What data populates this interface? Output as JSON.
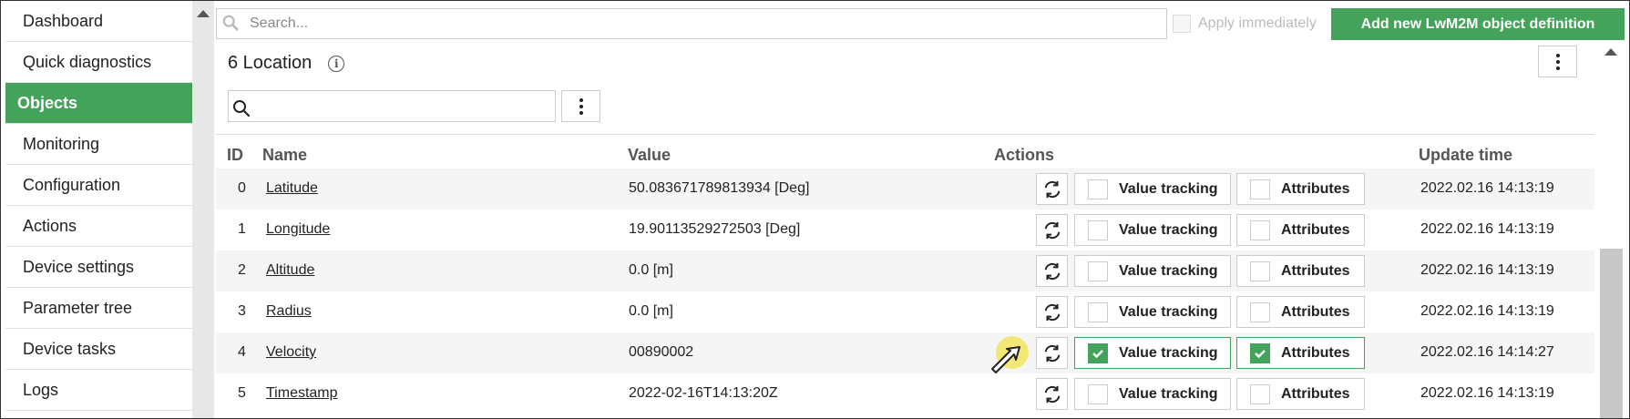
{
  "sidebar": {
    "items": [
      {
        "label": "Dashboard",
        "active": false
      },
      {
        "label": "Quick diagnostics",
        "active": false
      },
      {
        "label": "Objects",
        "active": true
      },
      {
        "label": "Monitoring",
        "active": false
      },
      {
        "label": "Configuration",
        "active": false
      },
      {
        "label": "Actions",
        "active": false
      },
      {
        "label": "Device settings",
        "active": false
      },
      {
        "label": "Parameter tree",
        "active": false
      },
      {
        "label": "Device tasks",
        "active": false
      },
      {
        "label": "Logs",
        "active": false
      }
    ]
  },
  "topbar": {
    "search_placeholder": "Search...",
    "apply_label": "Apply immediately",
    "add_button_label": "Add new LwM2M object definition"
  },
  "object": {
    "title": "6 Location"
  },
  "table": {
    "headers": {
      "id": "ID",
      "name": "Name",
      "value": "Value",
      "actions": "Actions",
      "update": "Update time"
    },
    "action_labels": {
      "value_tracking": "Value tracking",
      "attributes": "Attributes"
    },
    "rows": [
      {
        "id": "0",
        "name": "Latitude",
        "value": "50.083671789813934 [Deg]",
        "value_tracking": false,
        "attributes": false,
        "update": "2022.02.16 14:13:19"
      },
      {
        "id": "1",
        "name": "Longitude",
        "value": "19.90113529272503 [Deg]",
        "value_tracking": false,
        "attributes": false,
        "update": "2022.02.16 14:13:19"
      },
      {
        "id": "2",
        "name": "Altitude",
        "value": "0.0 [m]",
        "value_tracking": false,
        "attributes": false,
        "update": "2022.02.16 14:13:19"
      },
      {
        "id": "3",
        "name": "Radius",
        "value": "0.0 [m]",
        "value_tracking": false,
        "attributes": false,
        "update": "2022.02.16 14:13:19"
      },
      {
        "id": "4",
        "name": "Velocity",
        "value": "00890002",
        "value_tracking": true,
        "attributes": true,
        "update": "2022.02.16 14:14:27"
      },
      {
        "id": "5",
        "name": "Timestamp",
        "value": "2022-02-16T14:13:20Z",
        "value_tracking": false,
        "attributes": false,
        "update": "2022.02.16 14:13:19"
      }
    ]
  },
  "colors": {
    "accent": "#43a35b",
    "border": "#cccccc",
    "alt_row": "#f5f5f5"
  },
  "icons": [
    "search-icon",
    "info-icon",
    "kebab-menu-icon",
    "refresh-icon",
    "check-icon",
    "cursor-icon"
  ]
}
